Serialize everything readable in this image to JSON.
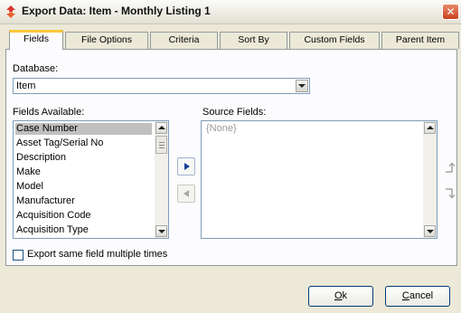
{
  "window": {
    "title": "Export Data:  Item - Monthly Listing 1",
    "close_glyph": "✕"
  },
  "tabs": [
    {
      "label": "Fields",
      "active": true
    },
    {
      "label": "File Options",
      "active": false
    },
    {
      "label": "Criteria",
      "active": false
    },
    {
      "label": "Sort By",
      "active": false
    },
    {
      "label": "Custom Fields",
      "active": false
    },
    {
      "label": "Parent Item",
      "active": false
    }
  ],
  "database": {
    "label": "Database:",
    "value": "Item"
  },
  "fields_available": {
    "label": "Fields Available:",
    "selected": "Case Number",
    "items": [
      "Case Number",
      "Asset Tag/Serial No",
      "Description",
      "Make",
      "Model",
      "Manufacturer",
      "Acquisition Code",
      "Acquisition Type"
    ]
  },
  "source_fields": {
    "label": "Source Fields:",
    "placeholder": "{None}"
  },
  "multiple_times": {
    "label": "Export same field multiple times",
    "checked": false
  },
  "buttons": {
    "ok_mnemonic": "O",
    "ok_rest": "k",
    "cancel_mnemonic": "C",
    "cancel_rest": "ancel"
  },
  "colors": {
    "tab_highlight": "#ffc73c",
    "selection": "#c0c0c0",
    "move_arrow": "#1a3f9b"
  }
}
